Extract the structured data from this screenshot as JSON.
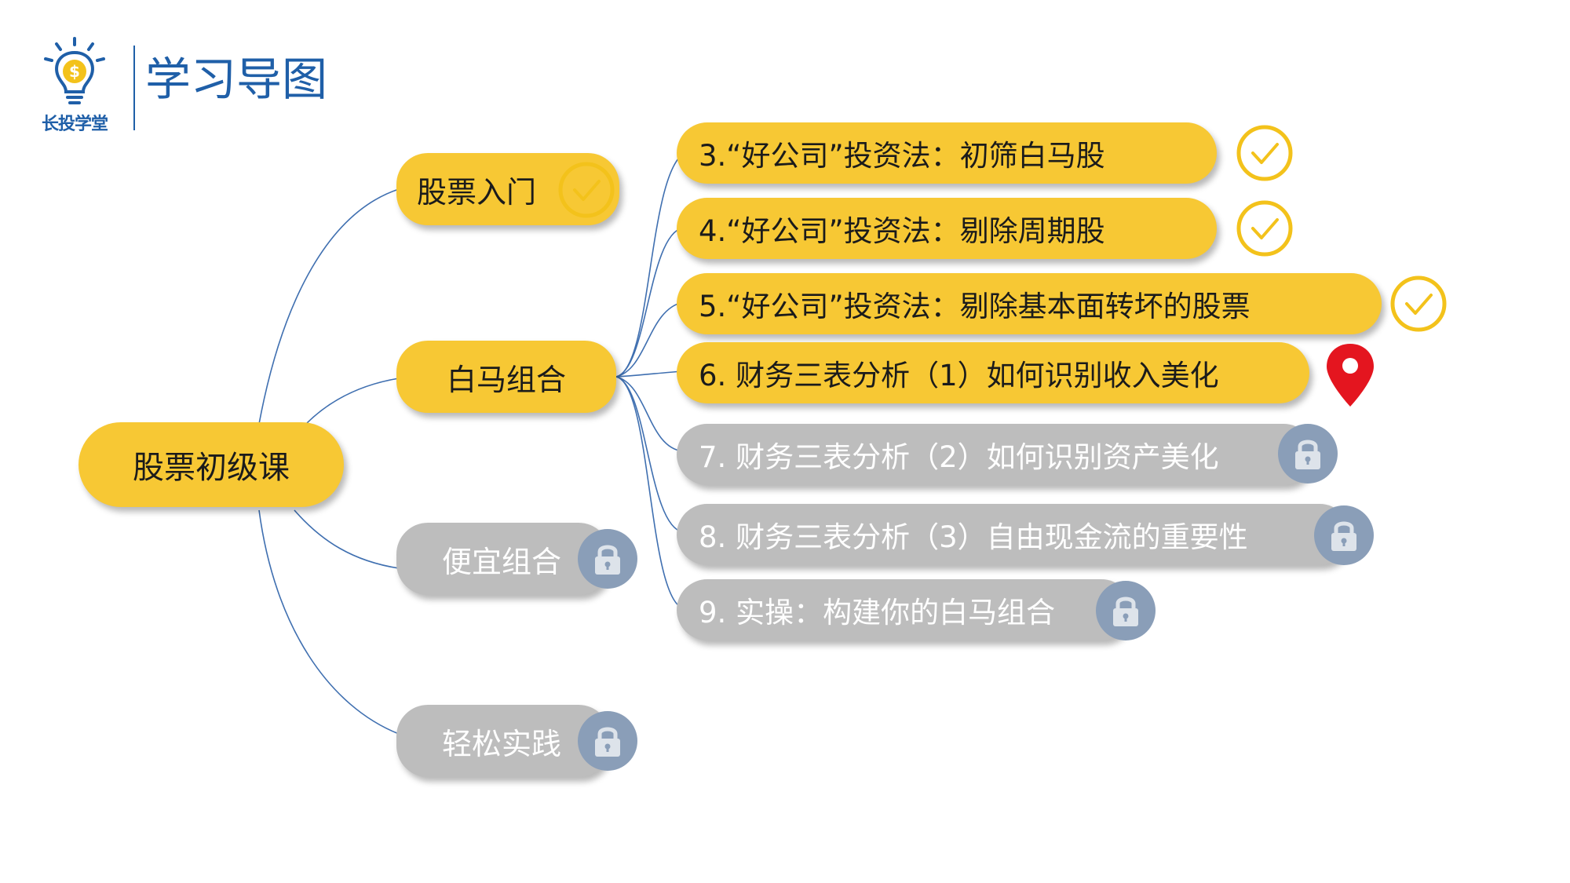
{
  "header": {
    "logo_text": "长投学堂",
    "title": "学习导图"
  },
  "colors": {
    "brand_blue": "#1f5fa8",
    "active_yellow": "#f7c834",
    "check_yellow": "#f3c21b",
    "locked_gray": "#bdbdbd",
    "lock_badge": "#8a9eb8",
    "marker_red": "#e4151f"
  },
  "mindmap": {
    "root": {
      "label": "股票初级课"
    },
    "branches": [
      {
        "label": "股票入门",
        "status": "completed",
        "status_icon": "check-icon"
      },
      {
        "label": "白马组合",
        "status": "in-progress"
      },
      {
        "label": "便宜组合",
        "status": "locked",
        "status_icon": "lock-icon"
      },
      {
        "label": "轻松实践",
        "status": "locked",
        "status_icon": "lock-icon"
      }
    ],
    "lessons": [
      {
        "label": "3.“好公司”投资法：初筛白马股",
        "status": "completed",
        "status_icon": "check-icon"
      },
      {
        "label": "4.“好公司”投资法：剔除周期股",
        "status": "completed",
        "status_icon": "check-icon"
      },
      {
        "label": "5.“好公司”投资法：剔除基本面转坏的股票",
        "status": "completed",
        "status_icon": "check-icon"
      },
      {
        "label": "6. 财务三表分析（1）如何识别收入美化",
        "status": "current",
        "status_icon": "location-pin-icon"
      },
      {
        "label": "7. 财务三表分析（2）如何识别资产美化",
        "status": "locked",
        "status_icon": "lock-icon"
      },
      {
        "label": "8. 财务三表分析（3）自由现金流的重要性",
        "status": "locked",
        "status_icon": "lock-icon"
      },
      {
        "label": "9. 实操：构建你的白马组合",
        "status": "locked",
        "status_icon": "lock-icon"
      }
    ]
  }
}
